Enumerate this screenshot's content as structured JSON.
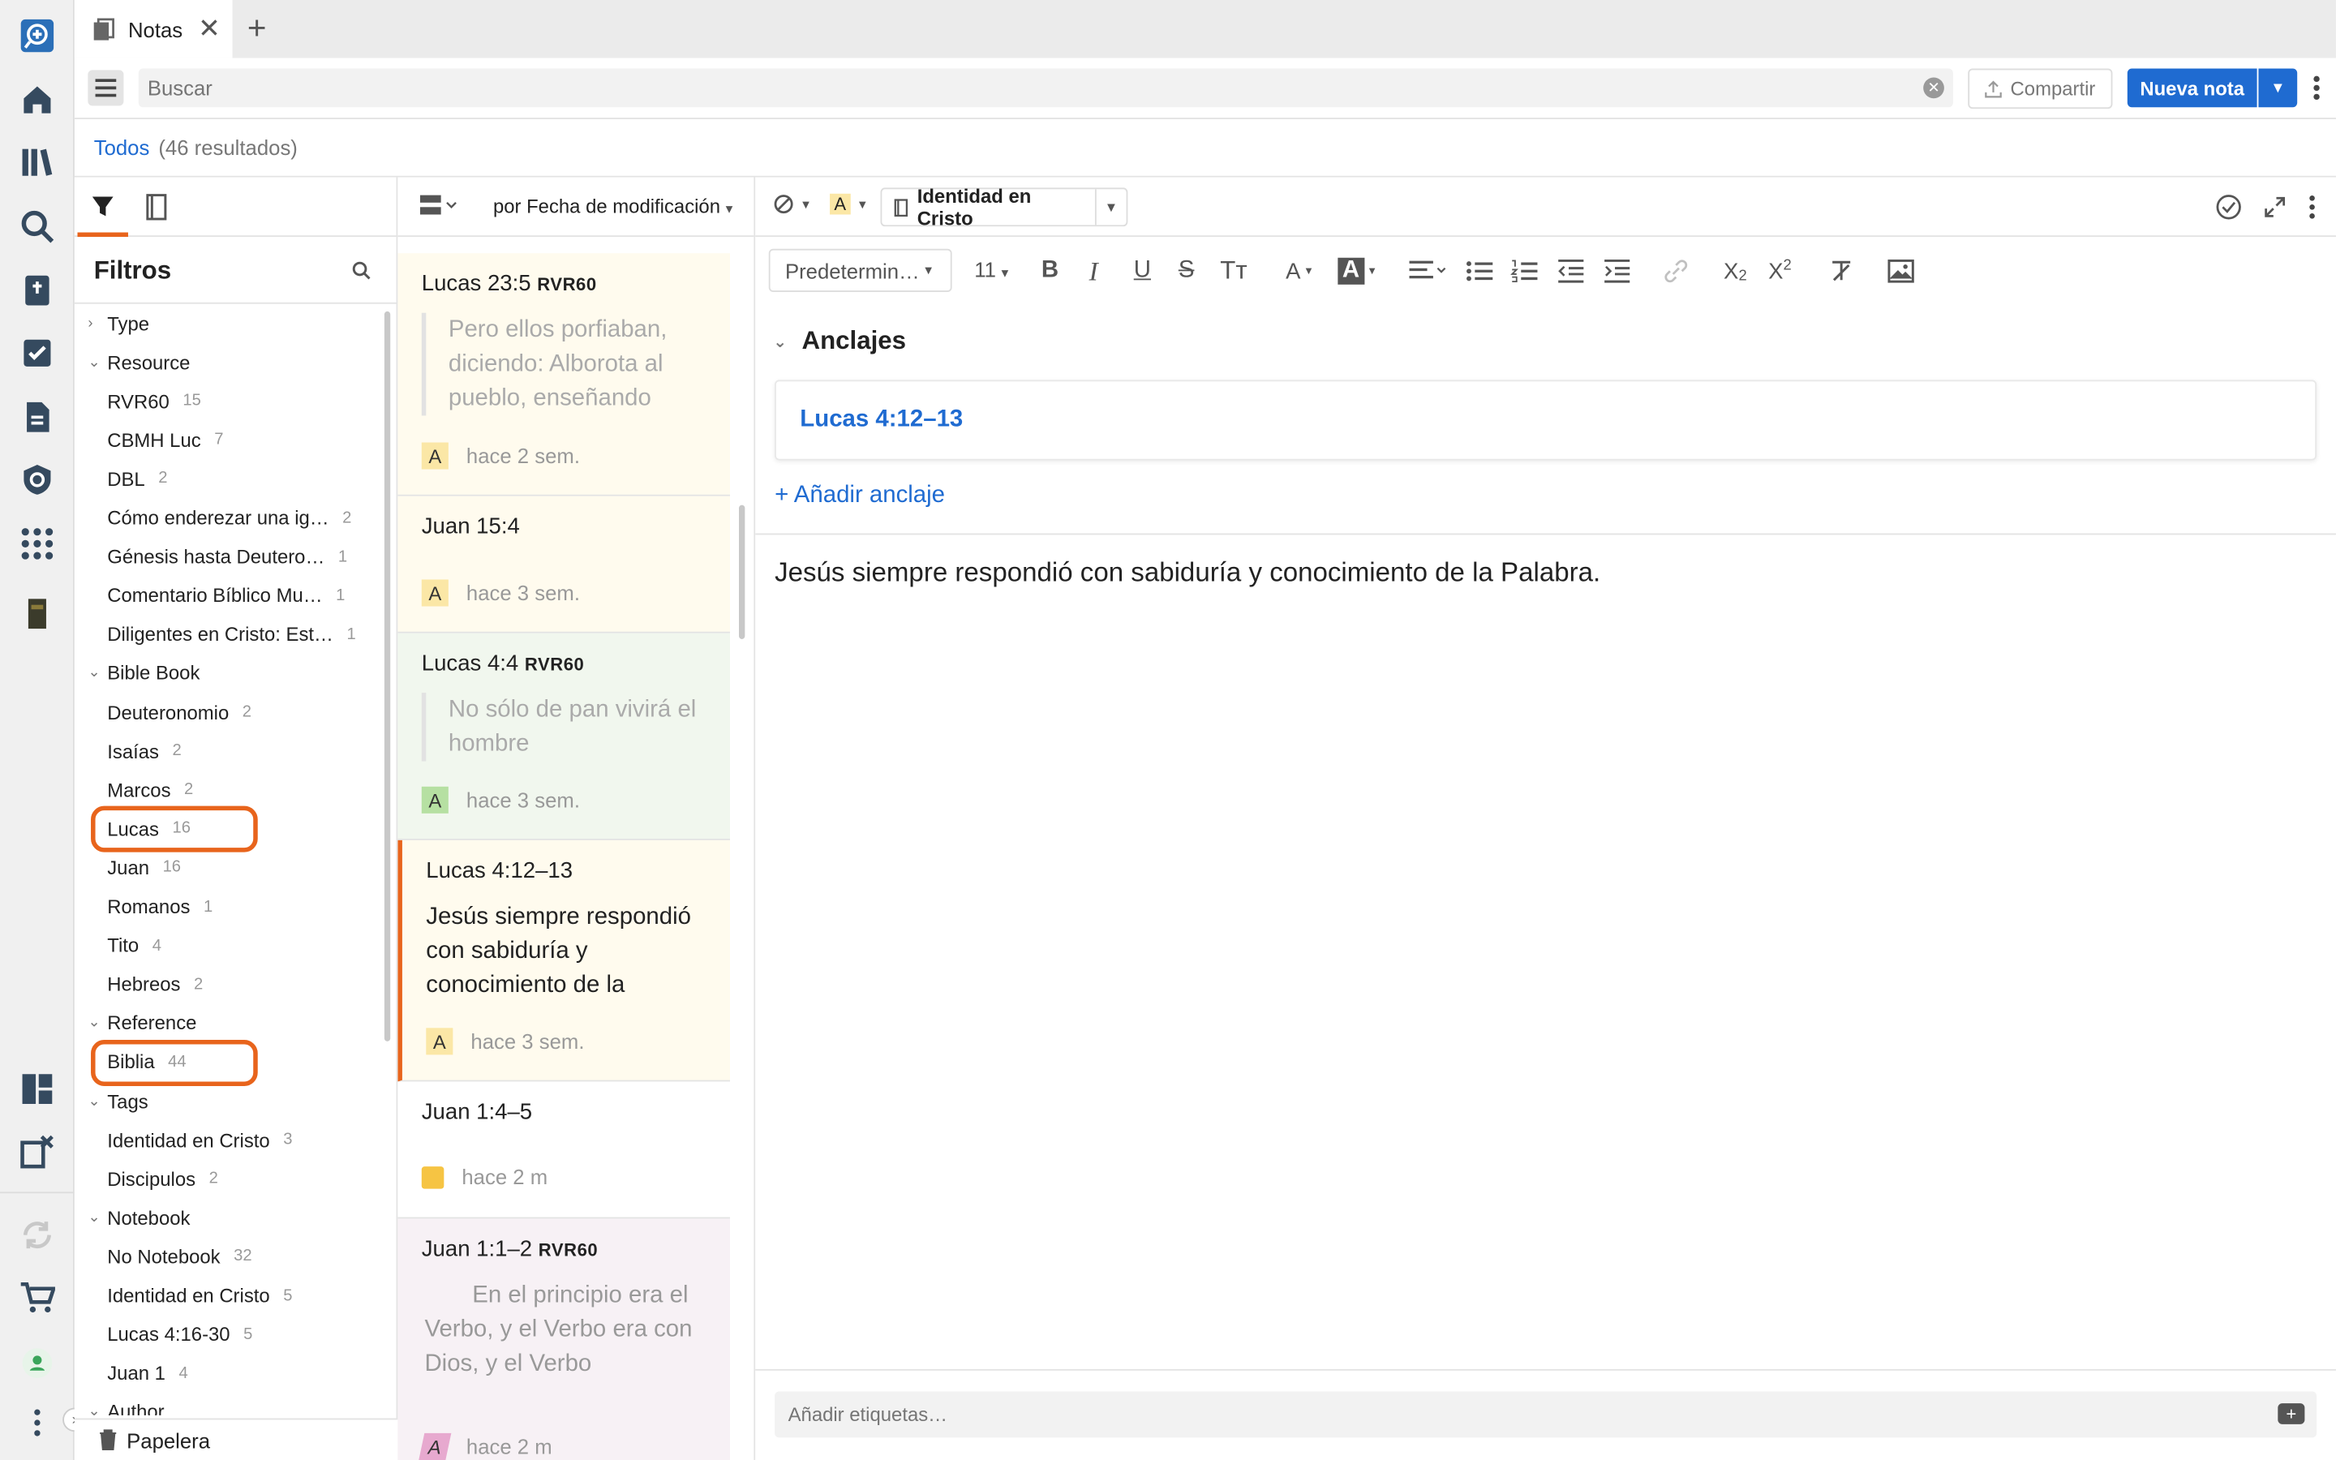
{
  "tab": {
    "title": "Notas",
    "close": "✕",
    "new": "+"
  },
  "toolbar": {
    "search_placeholder": "Buscar",
    "share_label": "Compartir",
    "new_note_label": "Nueva nota"
  },
  "results": {
    "all_label": "Todos",
    "count": "(46 resultados)"
  },
  "filters": {
    "title": "Filtros",
    "groups": [
      {
        "label": "Type",
        "expanded": false,
        "items": []
      },
      {
        "label": "Resource",
        "expanded": true,
        "items": [
          {
            "label": "RVR60",
            "count": "15"
          },
          {
            "label": "CBMH Luc",
            "count": "7"
          },
          {
            "label": "DBL",
            "count": "2"
          },
          {
            "label": "Cómo enderezar una ig…",
            "count": "2"
          },
          {
            "label": "Génesis hasta Deutero…",
            "count": "1"
          },
          {
            "label": "Comentario Bíblico Mu…",
            "count": "1"
          },
          {
            "label": "Diligentes en Cristo: Est…",
            "count": "1"
          }
        ]
      },
      {
        "label": "Bible Book",
        "expanded": true,
        "items": [
          {
            "label": "Deuteronomio",
            "count": "2"
          },
          {
            "label": "Isaías",
            "count": "2"
          },
          {
            "label": "Marcos",
            "count": "2"
          },
          {
            "label": "Lucas",
            "count": "16",
            "highlighted": true
          },
          {
            "label": "Juan",
            "count": "16"
          },
          {
            "label": "Romanos",
            "count": "1"
          },
          {
            "label": "Tito",
            "count": "4"
          },
          {
            "label": "Hebreos",
            "count": "2"
          }
        ]
      },
      {
        "label": "Reference",
        "expanded": true,
        "items": [
          {
            "label": "Biblia",
            "count": "44",
            "highlighted": true
          }
        ]
      },
      {
        "label": "Tags",
        "expanded": true,
        "items": [
          {
            "label": "Identidad en Cristo",
            "count": "3"
          },
          {
            "label": "Discipulos",
            "count": "2"
          }
        ]
      },
      {
        "label": "Notebook",
        "expanded": true,
        "items": [
          {
            "label": "No Notebook",
            "count": "32"
          },
          {
            "label": "Identidad en Cristo",
            "count": "5"
          },
          {
            "label": "Lucas 4:16-30",
            "count": "5"
          },
          {
            "label": "Juan 1",
            "count": "4"
          }
        ]
      },
      {
        "label": "Author",
        "expanded": true,
        "items": []
      }
    ],
    "trash_label": "Papelera"
  },
  "notelist": {
    "sort_label": "por Fecha de modificación",
    "cards": [
      {
        "ref": "Lucas 23:5",
        "version": "RVR60",
        "quote": "Pero ellos porfiaban, diciendo: Alborota al pueblo, enseñando",
        "time": "hace 2 sem.",
        "bg": "#fffbee",
        "marker": "A",
        "marker_color": "#fbe7a6"
      },
      {
        "ref": "Juan 15:4",
        "version": "",
        "quote": "",
        "time": "hace 3 sem.",
        "bg": "#fffbee",
        "marker": "A",
        "marker_color": "#fbe7a6"
      },
      {
        "ref": "Lucas 4:4",
        "version": "RVR60",
        "quote": "No sólo de pan vivirá el hombre",
        "time": "hace 3 sem.",
        "bg": "#f1f7ee",
        "marker": "A",
        "marker_color": "#b6e0a2"
      },
      {
        "ref": "Lucas 4:12–13",
        "version": "",
        "body": "Jesús siempre respondió con sabiduría y conocimiento de la",
        "time": "hace 3 sem.",
        "bg": "#fffbee",
        "marker": "A",
        "marker_color": "#fbe7a6",
        "selected": true
      },
      {
        "ref": "Juan 1:4–5",
        "version": "",
        "quote": "",
        "time": "hace 2 m",
        "bg": "#ffffff",
        "marker": "",
        "marker_color": "#f6c443"
      },
      {
        "ref": "Juan 1:1–2",
        "version": "RVR60",
        "quote": "En el principio era el Verbo, y el Verbo era con Dios, y el Verbo",
        "time": "hace 2 m",
        "bg": "#f7f1f5",
        "marker": "A",
        "marker_color": "#e7a9cf"
      }
    ]
  },
  "editor": {
    "notebook_label": "Identidad en Cristo",
    "font_label": "Predetermin…",
    "size_label": "11",
    "anchors_title": "Anclajes",
    "anchor_ref": "Lucas 4:12–13",
    "add_anchor": "+ Añadir anclaje",
    "note_text": "Jesús siempre respondió con sabiduría y conocimiento de la Palabra.",
    "tags_placeholder": "Añadir etiquetas…"
  },
  "colors": {
    "accent": "#1f6bd1",
    "highlight": "#e8641c"
  }
}
